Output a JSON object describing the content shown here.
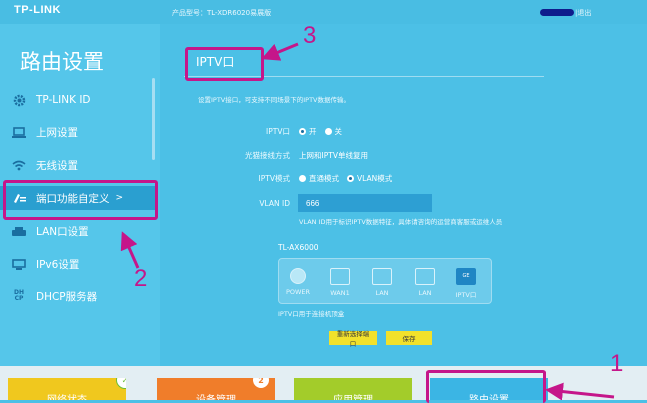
{
  "header": {
    "logo": "TP-LINK",
    "model": "产品型号：TL-XDR6020易展版",
    "logout": "|退出"
  },
  "sidebar": {
    "title": "路由设置",
    "items": [
      {
        "label": "TP-LINK ID",
        "icon": "gear-icon"
      },
      {
        "label": "上网设置",
        "icon": "laptop-icon"
      },
      {
        "label": "无线设置",
        "icon": "wifi-icon"
      },
      {
        "label": "端口功能自定义",
        "icon": "edit-icon",
        "active": true,
        "chevron": ">"
      },
      {
        "label": "LAN口设置",
        "icon": "router-icon"
      },
      {
        "label": "IPv6设置",
        "icon": "monitor-icon"
      },
      {
        "label": "DHCP服务器",
        "icon": "dhcp-icon"
      }
    ]
  },
  "main": {
    "section_title": "IPTV口",
    "description": "设置IPTV接口，可支持不同场景下的IPTV数据传输。",
    "rows": {
      "iptv_port": {
        "label": "IPTV口",
        "on": "开",
        "off": "关"
      },
      "fiber_mode": {
        "label": "光猫接线方式",
        "value": "上网和IPTV单线复用"
      },
      "iptv_mode": {
        "label": "IPTV模式",
        "opt1": "直通模式",
        "opt2": "VLAN模式"
      },
      "vlan_id": {
        "label": "VLAN ID",
        "value": "666",
        "hint": "VLAN ID用于标识IPTV数据特征，具体请咨询的运营商客服或运维人员"
      }
    },
    "device_name": "TL-AX6000",
    "ports": [
      {
        "label": "POWER"
      },
      {
        "label": "WAN1"
      },
      {
        "label": "LAN"
      },
      {
        "label": "LAN"
      },
      {
        "label": "IPTV口",
        "selected": true,
        "tag": "GE"
      }
    ],
    "port_note": "IPTV口用于连接机顶盒",
    "buttons": {
      "reselect": "重新选择端口",
      "save": "保存"
    }
  },
  "bottom_tiles": [
    {
      "label": "网络状态",
      "color": "#f0c81e",
      "badge": "✓"
    },
    {
      "label": "设备管理",
      "color": "#f07d2a",
      "badge": "2"
    },
    {
      "label": "应用管理",
      "color": "#a3cc2a",
      "badge": ""
    },
    {
      "label": "路由设置",
      "color": "#3bb5e4",
      "badge": ""
    }
  ],
  "annotations": {
    "n1": "1",
    "n2": "2",
    "n3": "3",
    "color": "#c5168a"
  }
}
